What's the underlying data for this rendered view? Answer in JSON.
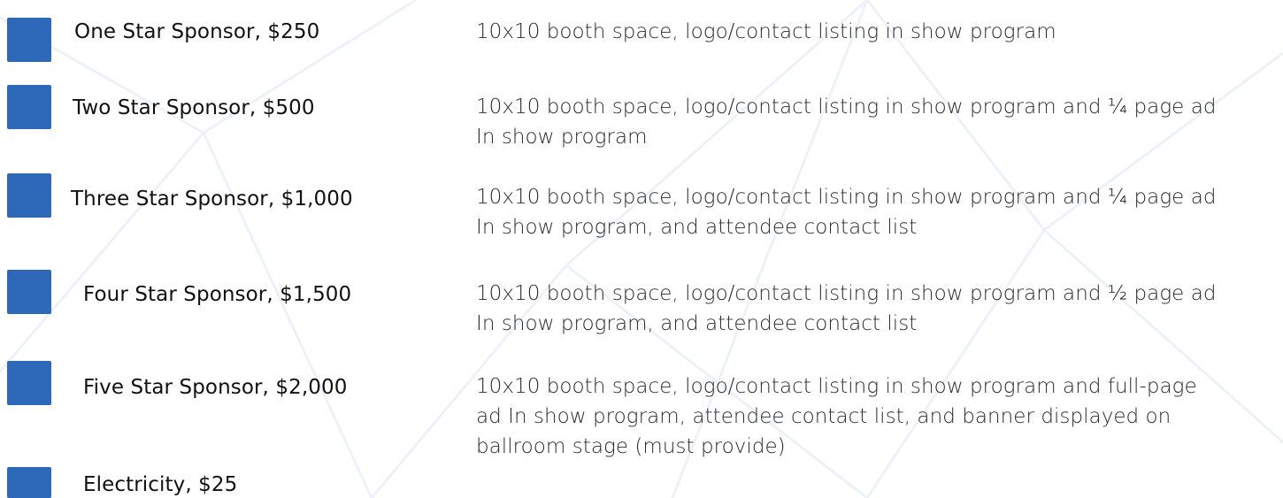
{
  "colors": {
    "square": "#2d68b9",
    "background_lines": "#eef0fa"
  },
  "tiers": [
    {
      "name": "One Star Sponsor, $250",
      "description": [
        "10x10 booth space, logo/contact listing in show program"
      ]
    },
    {
      "name": "Two Star Sponsor, $500",
      "description": [
        "10x10 booth space, logo/contact listing in show program and ¼ page ad",
        "In show program"
      ]
    },
    {
      "name": "Three Star Sponsor, $1,000",
      "description": [
        "10x10 booth space, logo/contact listing in show program and ¼ page ad",
        "In show program, and attendee contact list"
      ]
    },
    {
      "name": "Four Star Sponsor, $1,500",
      "description": [
        "10x10 booth space, logo/contact listing in show program and ½ page ad",
        "In show program, and attendee contact list"
      ]
    },
    {
      "name": "Five Star Sponsor, $2,000",
      "description": [
        "10x10 booth space, logo/contact listing in show program and full-page",
        "ad In show program, attendee contact list, and banner displayed on",
        "ballroom stage (must provide)"
      ]
    },
    {
      "name": "Electricity, $25",
      "description": []
    }
  ]
}
